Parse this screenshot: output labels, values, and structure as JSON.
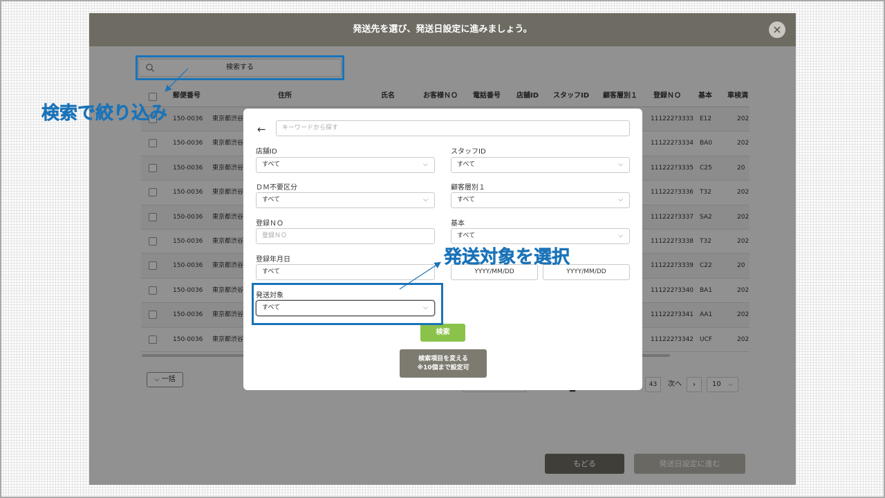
{
  "window": {
    "title": "発送先を選び、発送日設定に進みましょう。",
    "close_label": "×"
  },
  "search_bar": {
    "label": "検索する"
  },
  "table": {
    "headers": [
      "郵便番号",
      "住所",
      "氏名",
      "お客様ＮＯ",
      "電話番号",
      "店舗ID",
      "スタッフID",
      "顧客層別１",
      "登録ＮＯ",
      "基本",
      "車検満"
    ],
    "rows": [
      {
        "zip": "150-0036",
        "address": "東京都渋谷",
        "reg_no": "111222?3333",
        "basic": "E12",
        "exp": "202"
      },
      {
        "zip": "150-0036",
        "address": "東京都渋谷",
        "reg_no": "111222?3334",
        "basic": "BA0",
        "exp": "202"
      },
      {
        "zip": "150-0036",
        "address": "東京都渋谷",
        "reg_no": "111222?3335",
        "basic": "C25",
        "exp": "20"
      },
      {
        "zip": "150-0036",
        "address": "東京都渋谷",
        "reg_no": "111222?3336",
        "basic": "T32",
        "exp": "202"
      },
      {
        "zip": "150-0036",
        "address": "東京都渋谷",
        "reg_no": "111222?3337",
        "basic": "SA2",
        "exp": "202"
      },
      {
        "zip": "150-0036",
        "address": "東京都渋谷",
        "reg_no": "111222?3338",
        "basic": "T32",
        "exp": "202"
      },
      {
        "zip": "150-0036",
        "address": "東京都渋谷",
        "reg_no": "111222?3339",
        "basic": "C22",
        "exp": "20"
      },
      {
        "zip": "150-0036",
        "address": "東京都渋谷",
        "reg_no": "111222?3340",
        "basic": "BA1",
        "exp": "202"
      },
      {
        "zip": "150-0036",
        "address": "東京都渋谷",
        "reg_no": "111222?3341",
        "basic": "AA1",
        "exp": "202"
      },
      {
        "zip": "150-0036",
        "address": "東京都渋谷",
        "reg_no": "111222?3342",
        "basic": "UCF",
        "exp": "202"
      }
    ]
  },
  "bulk": {
    "label": "一括"
  },
  "pagination": {
    "last_page": "43",
    "next_label": "次へ",
    "next_arrow": "›",
    "per_page": "10"
  },
  "footer": {
    "back_label": "もどる",
    "next_label": "発送日設定に進む"
  },
  "modal": {
    "back_arrow": "←",
    "keyword_placeholder": "キーワードから探す",
    "store_id": {
      "label": "店舗ID",
      "value": "すべて"
    },
    "staff_id": {
      "label": "スタッフID",
      "value": "すべて"
    },
    "dm": {
      "label": "ＤＭ不要区分",
      "value": "すべて"
    },
    "segment": {
      "label": "顧客層別１",
      "value": "すべて"
    },
    "reg_no": {
      "label": "登録ＮＯ",
      "placeholder": "登録ＮＯ"
    },
    "basic": {
      "label": "基本",
      "value": "すべて"
    },
    "reg_date": {
      "label": "登録年月日",
      "value": "すべて"
    },
    "date_range": {
      "from": "YYYY/MM/DD",
      "to": "YYYY/MM/DD"
    },
    "target": {
      "label": "発送対象",
      "value": "すべて"
    },
    "search_label": "検索",
    "change_label_1": "検索項目を変える",
    "change_label_2": "※10個まで設定可"
  },
  "annotations": {
    "filter_text": "検索で絞り込み",
    "target_text": "発送対象を選択",
    "color": "#1a73b8"
  }
}
